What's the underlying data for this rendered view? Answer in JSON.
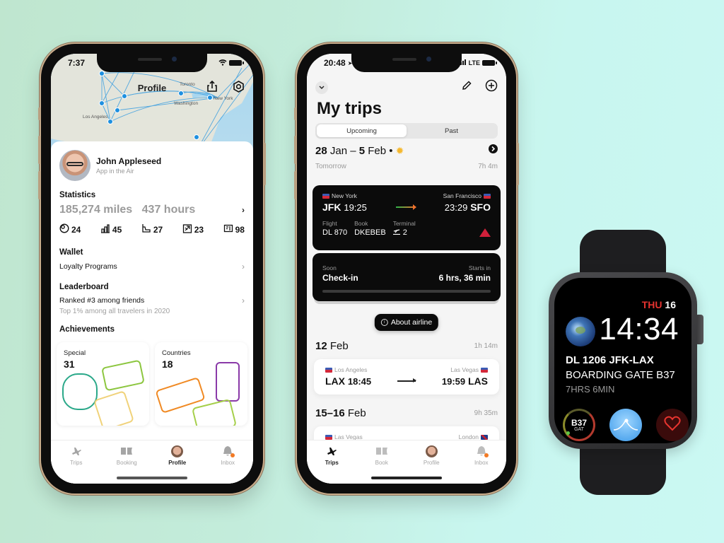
{
  "colors": {
    "accent_orange": "#f27a25",
    "delta_red": "#d0203a",
    "watch_day_red": "#e5332f",
    "map_dot_blue": "#1e90e0"
  },
  "profile_phone": {
    "status_time": "7:37",
    "map_title": "Profile",
    "map_labels": [
      "Toronto",
      "Washington",
      "New York",
      "Los Angeles"
    ],
    "user": {
      "name": "John Appleseed",
      "subtitle": "App in the Air"
    },
    "statistics": {
      "title": "Statistics",
      "miles": "185,274 miles",
      "hours": "437 hours",
      "counts": [
        {
          "icon": "globe-pin-icon",
          "value": "24"
        },
        {
          "icon": "city-icon",
          "value": "45"
        },
        {
          "icon": "airport-seat-icon",
          "value": "27"
        },
        {
          "icon": "airport-icon",
          "value": "23"
        },
        {
          "icon": "airline-icon",
          "value": "98"
        }
      ]
    },
    "wallet": {
      "title": "Wallet",
      "item": "Loyalty Programs"
    },
    "leaderboard": {
      "title": "Leaderboard",
      "rank": "Ranked #3 among friends",
      "sub": "Top 1% among all travelers in 2020"
    },
    "achievements": {
      "title": "Achievements",
      "cards": [
        {
          "label": "Special",
          "count": "31"
        },
        {
          "label": "Countries",
          "count": "18"
        }
      ]
    },
    "tabs": [
      {
        "label": "Trips",
        "icon": "plane-icon",
        "active": false
      },
      {
        "label": "Booking",
        "icon": "ticket-icon",
        "active": false
      },
      {
        "label": "Profile",
        "icon": "avatar",
        "active": true
      },
      {
        "label": "Inbox",
        "icon": "bell-icon",
        "active": false
      }
    ]
  },
  "trips_phone": {
    "status_time": "20:48",
    "status_network": "LTE",
    "title": "My trips",
    "segments": [
      "Upcoming",
      "Past"
    ],
    "active_segment": "Upcoming",
    "trip1": {
      "date_bold_1": "28",
      "date_mid": " Jan – ",
      "date_bold_2": "5",
      "date_end": " Feb •",
      "when": "Tomorrow",
      "duration": "7h 4m",
      "flight_card": {
        "from_city": "New York",
        "to_city": "San Francisco",
        "from_code": "JFK",
        "from_time": "19:25",
        "to_time": "23:29",
        "to_code": "SFO",
        "flight_label": "Flight",
        "flight_value": "DL 870",
        "book_label": "Book",
        "book_value": "DKEBEB",
        "terminal_label": "Terminal",
        "terminal_value": "2"
      },
      "checkin_card": {
        "soon_label": "Soon",
        "title": "Check-in",
        "starts_label": "Starts in",
        "starts_value": "6 hrs, 36 min"
      },
      "about_button": "About airline"
    },
    "trip2": {
      "date_bold": "12",
      "date_end": " Feb",
      "duration": "1h 14m",
      "from_city": "Los Angeles",
      "to_city": "Las Vegas",
      "from_code": "LAX",
      "from_time": "18:45",
      "to_time": "19:59",
      "to_code": "LAS"
    },
    "trip3": {
      "date_bold": "15–16",
      "date_end": " Feb",
      "duration": "9h 35m",
      "from_city": "Las Vegas",
      "to_city": "London"
    },
    "tabs": [
      {
        "label": "Trips",
        "icon": "plane-icon",
        "active": true
      },
      {
        "label": "Book",
        "icon": "ticket-icon",
        "active": false
      },
      {
        "label": "Profile",
        "icon": "avatar",
        "active": false
      },
      {
        "label": "Inbox",
        "icon": "bell-icon",
        "active": false
      }
    ]
  },
  "watch": {
    "day": "THU",
    "date": "16",
    "time": "14:34",
    "flight": "DL 1206 JFK-LAX",
    "gate_line": "BOARDING GATE B37",
    "duration": "7HRS 6MIN",
    "gate_complication": {
      "value": "B37",
      "label": "GAT"
    }
  }
}
